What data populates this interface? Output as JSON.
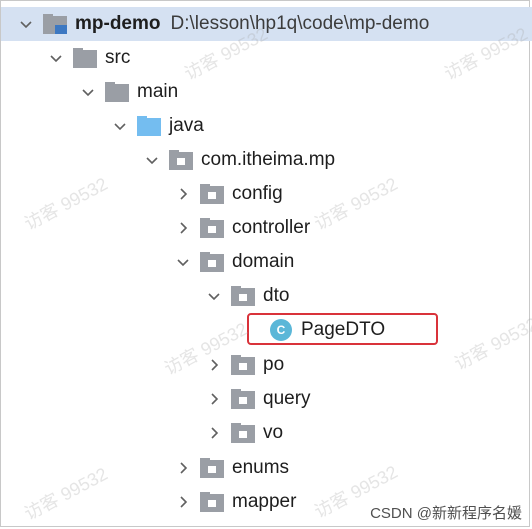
{
  "tree": {
    "root": {
      "label": "mp-demo",
      "path": "D:\\lesson\\hp1q\\code\\mp-demo"
    },
    "src": "src",
    "main": "main",
    "java": "java",
    "package": "com.itheima.mp",
    "config": "config",
    "controller": "controller",
    "domain": "domain",
    "dto": "dto",
    "pagedto": "PageDTO",
    "class_badge_letter": "C",
    "po": "po",
    "query": "query",
    "vo": "vo",
    "enums": "enums",
    "mapper": "mapper"
  },
  "watermark": "访客 99532",
  "credit": "CSDN @新新程序名媛",
  "colors": {
    "root_row_bg": "#d5e1f2",
    "folder_gray": "#9a9ea5",
    "source_folder_blue": "#74bdf0",
    "class_badge": "#5bb7d8",
    "highlight_border": "#d9323a"
  },
  "icons": {
    "expanded": "chevron-down-icon",
    "collapsed": "chevron-right-icon",
    "module": "module-folder-icon",
    "folder": "folder-icon",
    "source_root": "source-folder-icon",
    "package": "package-icon",
    "class": "class-icon"
  }
}
